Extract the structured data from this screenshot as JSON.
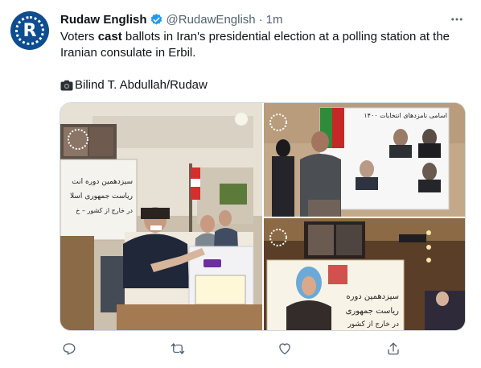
{
  "account": {
    "name": "Rudaw English",
    "handle": "@RudawEnglish",
    "separator": "·",
    "time": "1m",
    "avatar_letter": "R",
    "brand_color": "#0e4d8f",
    "verified_color": "#1d9bf0"
  },
  "tweet": {
    "text_before": "Voters ",
    "text_bold": "cast",
    "text_after": " ballots in Iran's presidential election at a polling station at the Iranian consulate in Erbil.",
    "credit": "Bilind T. Abdullah/Rudaw",
    "credit_icon": "camera-icon"
  },
  "media": {
    "photos": [
      {
        "description_name": "photo-ballot-box"
      },
      {
        "description_name": "photo-voter-at-candidate-poster"
      },
      {
        "description_name": "photo-woman-voter"
      }
    ],
    "poster_text_1": "سیزدهمین دوره انت",
    "poster_text_2": "ریاست جمهوری اسلا",
    "poster_text_3": "در خارج از کشور – خ",
    "candidates_banner": "اسامی نامزدهای انتخابات ۱۴۰۰",
    "sign_text_1": "سیزدهمین دوره",
    "sign_text_2": "ریاست جمهوری",
    "sign_text_3": "در خارج از کشور"
  },
  "actions": {
    "reply_icon": "reply-icon",
    "retweet_icon": "retweet-icon",
    "like_icon": "heart-icon",
    "share_icon": "share-icon"
  }
}
